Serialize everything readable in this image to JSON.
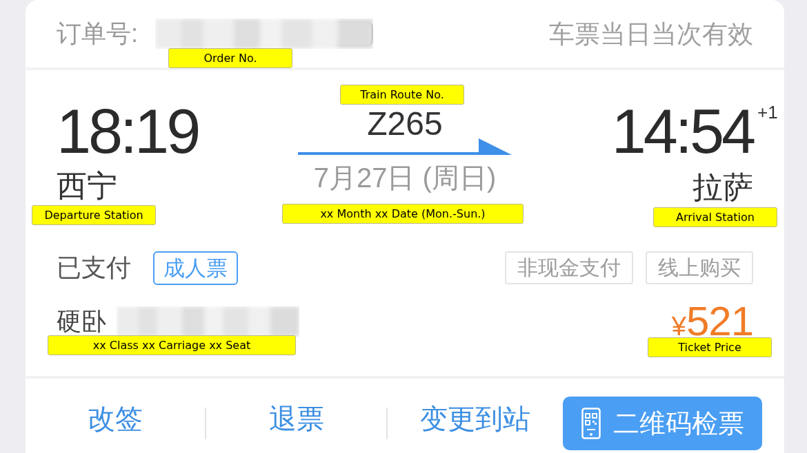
{
  "header": {
    "order_label": "订单号:",
    "order_annotation": "Order No.",
    "validity": "车票当日当次有效"
  },
  "journey": {
    "departure": {
      "time": "18:19",
      "station": "西宁",
      "annotation": "Departure Station"
    },
    "train": {
      "number": "Z265",
      "number_annotation": "Train Route No.",
      "date": "7月27日 (周日)",
      "date_annotation": "xx Month xx Date (Mon.-Sun.)"
    },
    "arrival": {
      "time": "14:54",
      "day_offset": "+1",
      "station": "拉萨",
      "annotation": "Arrival Station"
    }
  },
  "payment": {
    "status": "已支付",
    "ticket_type": "成人票",
    "tags": [
      "非现金支付",
      "线上购买"
    ]
  },
  "seat": {
    "class": "硬卧",
    "annotation": "xx Class xx Carriage xx Seat",
    "currency": "¥",
    "price": "521",
    "price_annotation": "Ticket Price"
  },
  "actions": [
    {
      "label": "改签",
      "kind": "link"
    },
    {
      "label": "退票",
      "kind": "link"
    },
    {
      "label": "变更到站",
      "kind": "link"
    },
    {
      "label": "二维码检票",
      "kind": "primary"
    }
  ]
}
